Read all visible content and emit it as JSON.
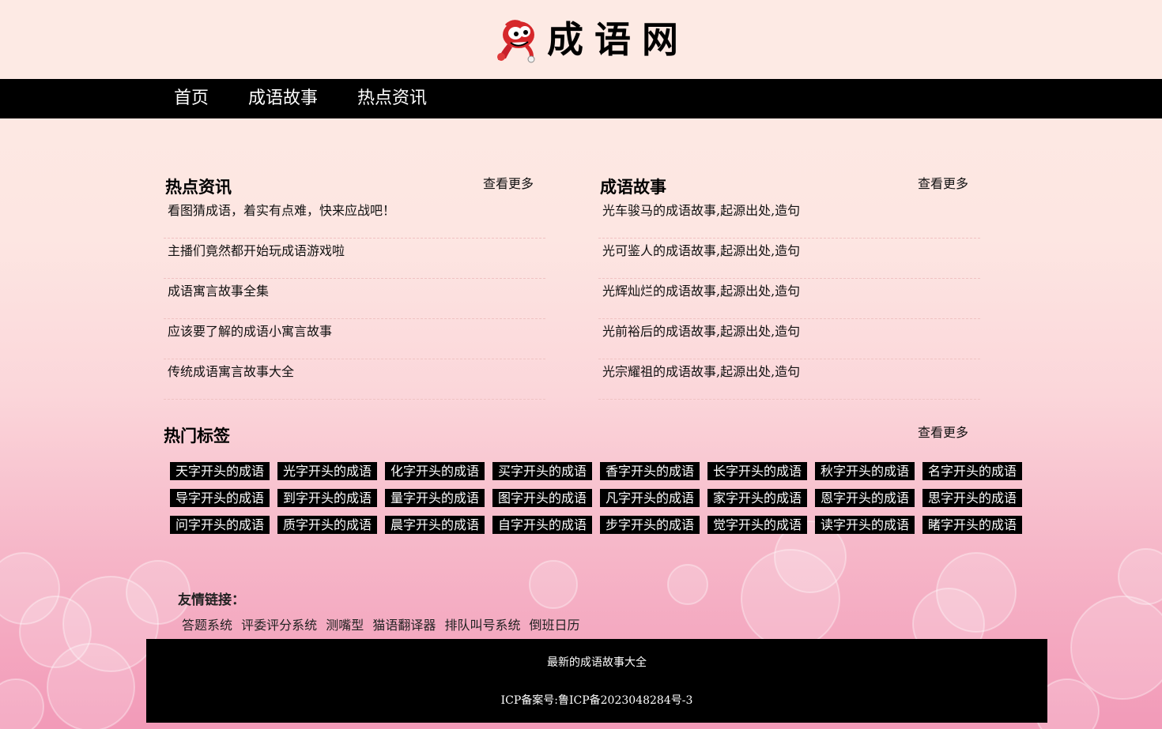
{
  "header": {
    "site_title": "成语网",
    "logo_icon": "cartoon-mascot-icon"
  },
  "nav": {
    "items": [
      {
        "label": "首页"
      },
      {
        "label": "成语故事"
      },
      {
        "label": "热点资讯"
      }
    ]
  },
  "hot_news": {
    "title": "热点资讯",
    "more": "查看更多",
    "items": [
      "看图猜成语，着实有点难，快来应战吧！",
      "主播们竟然都开始玩成语游戏啦",
      "成语寓言故事全集",
      "应该要了解的成语小寓言故事",
      "传统成语寓言故事大全"
    ]
  },
  "idiom_stories": {
    "title": "成语故事",
    "more": "查看更多",
    "items": [
      "光车骏马的成语故事,起源出处,造句",
      "光可鉴人的成语故事,起源出处,造句",
      "光辉灿烂的成语故事,起源出处,造句",
      "光前裕后的成语故事,起源出处,造句",
      "光宗耀祖的成语故事,起源出处,造句"
    ]
  },
  "hot_tags": {
    "title": "热门标签",
    "more": "查看更多",
    "tags": [
      "天字开头的成语",
      "光字开头的成语",
      "化字开头的成语",
      "买字开头的成语",
      "香字开头的成语",
      "长字开头的成语",
      "秋字开头的成语",
      "名字开头的成语",
      "导字开头的成语",
      "到字开头的成语",
      "量字开头的成语",
      "图字开头的成语",
      "凡字开头的成语",
      "家字开头的成语",
      "恩字开头的成语",
      "思字开头的成语",
      "问字开头的成语",
      "质字开头的成语",
      "晨字开头的成语",
      "自字开头的成语",
      "步字开头的成语",
      "觉字开头的成语",
      "读字开头的成语",
      "睹字开头的成语"
    ]
  },
  "friends": {
    "title": "友情链接：",
    "links": [
      "答题系统",
      "评委评分系统",
      "测嘴型",
      "猫语翻译器",
      "排队叫号系统",
      "倒班日历"
    ]
  },
  "footer": {
    "line1": "最新的成语故事大全",
    "line2": "ICP备案号:鲁ICP备2023048284号-3"
  },
  "colors": {
    "page_top": "#fdeae4",
    "page_bottom": "#f29ab8",
    "nav_bg": "#000000",
    "tag_bg": "#000000"
  }
}
